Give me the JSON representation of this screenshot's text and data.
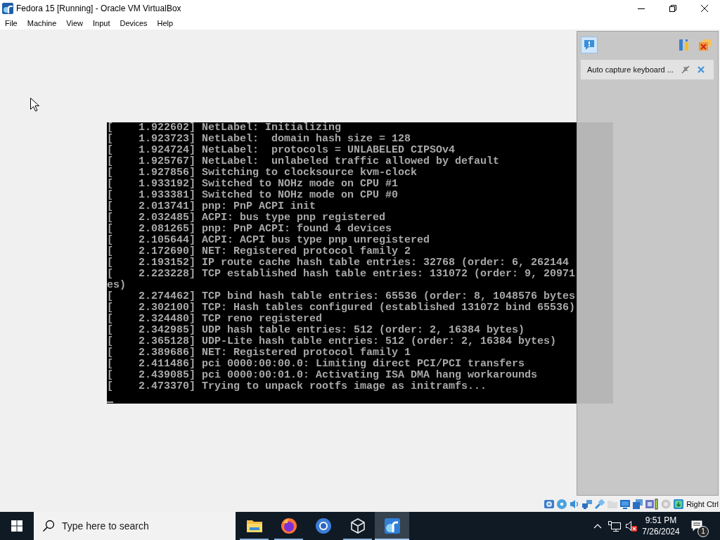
{
  "window": {
    "title": "Fedora 15 [Running] - Oracle VM VirtualBox"
  },
  "menu": [
    "File",
    "Machine",
    "View",
    "Input",
    "Devices",
    "Help"
  ],
  "console": {
    "lines": [
      "[    1.922602] NetLabel: Initializing",
      "[    1.923723] NetLabel:  domain hash size = 128",
      "[    1.924724] NetLabel:  protocols = UNLABELED CIPSOv4",
      "[    1.925767] NetLabel:  unlabeled traffic allowed by default",
      "[    1.927856] Switching to clocksource kvm-clock",
      "[    1.933192] Switched to NOHz mode on CPU #1",
      "[    1.933381] Switched to NOHz mode on CPU #0",
      "[    2.013741] pnp: PnP ACPI init",
      "[    2.032485] ACPI: bus type pnp registered",
      "[    2.081265] pnp: PnP ACPI: found 4 devices",
      "[    2.105644] ACPI: ACPI bus type pnp unregistered",
      "[    2.172690] NET: Registered protocol family 2",
      "[    2.193152] IP route cache hash table entries: 32768 (order: 6, 262144",
      "[    2.223228] TCP established hash table entries: 131072 (order: 9, 20971",
      "es)",
      "[    2.274462] TCP bind hash table entries: 65536 (order: 8, 1048576 bytes",
      "[    2.302100] TCP: Hash tables configured (established 131072 bind 65536)",
      "[    2.324480] TCP reno registered",
      "[    2.342985] UDP hash table entries: 512 (order: 2, 16384 bytes)",
      "[    2.365128] UDP-Lite hash table entries: 512 (order: 2, 16384 bytes)",
      "[    2.389686] NET: Registered protocol family 1",
      "[    2.411486] pci 0000:00:00.0: Limiting direct PCI/PCI transfers",
      "[    2.439085] pci 0000:00:01.0: Activating ISA DMA hang workarounds",
      "[    2.473370] Trying to unpack rootfs image as initramfs..."
    ],
    "cursor": true
  },
  "notification_center": {
    "toggle": {
      "on": true
    },
    "messages": [
      {
        "text": "Auto capture keyboard ..."
      }
    ]
  },
  "status_bar": {
    "devices": [
      {
        "kind": "hard-disk",
        "disabled": false
      },
      {
        "kind": "optical",
        "disabled": false
      },
      {
        "kind": "audio",
        "disabled": false
      },
      {
        "kind": "network",
        "disabled": false
      },
      {
        "kind": "usb",
        "disabled": false
      },
      {
        "kind": "shared-folder",
        "disabled": true
      },
      {
        "kind": "display",
        "disabled": false
      },
      {
        "kind": "recording",
        "disabled": false
      },
      {
        "kind": "cpu",
        "disabled": false
      },
      {
        "kind": "mouse",
        "disabled": true
      },
      {
        "kind": "keyboard",
        "disabled": false
      }
    ],
    "host_key": "Right Ctrl"
  },
  "taskbar": {
    "search": {
      "placeholder": "Type here to search"
    },
    "apps": [
      {
        "kind": "explorer",
        "running": true,
        "selected": false
      },
      {
        "kind": "firefox",
        "running": true,
        "selected": false
      },
      {
        "kind": "ring-browser",
        "running": false,
        "selected": false
      },
      {
        "kind": "virtualbox",
        "running": true,
        "selected": false
      },
      {
        "kind": "vm",
        "running": true,
        "selected": true
      }
    ],
    "tray": {
      "muted": true,
      "time": "9:51 PM",
      "date": "7/26/2024",
      "notifications": "1"
    }
  }
}
